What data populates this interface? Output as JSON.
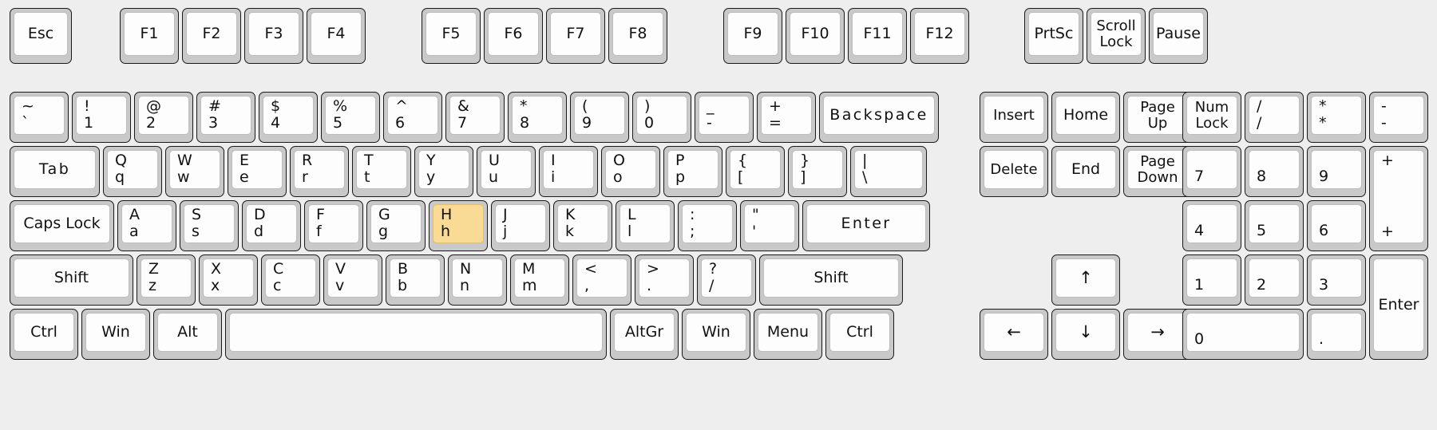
{
  "keyboard": {
    "name": "full-size-104-key-layout",
    "highlight_color": "#fadb95",
    "key_face_color": "#fdfdfd",
    "key_body_color": "#c9c9c9",
    "background_color": "#eeeeee",
    "highlighted_keys": [
      "H"
    ],
    "rows": {
      "function_row": [
        {
          "id": "esc",
          "label": "Esc",
          "type": "single"
        },
        {
          "id": "f1",
          "label": "F1",
          "type": "single"
        },
        {
          "id": "f2",
          "label": "F2",
          "type": "single"
        },
        {
          "id": "f3",
          "label": "F3",
          "type": "single"
        },
        {
          "id": "f4",
          "label": "F4",
          "type": "single"
        },
        {
          "id": "f5",
          "label": "F5",
          "type": "single"
        },
        {
          "id": "f6",
          "label": "F6",
          "type": "single"
        },
        {
          "id": "f7",
          "label": "F7",
          "type": "single"
        },
        {
          "id": "f8",
          "label": "F8",
          "type": "single"
        },
        {
          "id": "f9",
          "label": "F9",
          "type": "single"
        },
        {
          "id": "f10",
          "label": "F10",
          "type": "single"
        },
        {
          "id": "f11",
          "label": "F11",
          "type": "single"
        },
        {
          "id": "f12",
          "label": "F12",
          "type": "single"
        },
        {
          "id": "prtsc",
          "label": "PrtSc",
          "type": "single"
        },
        {
          "id": "scrolllock",
          "label": "Scroll\nLock",
          "type": "single"
        },
        {
          "id": "pause",
          "label": "Pause",
          "type": "single"
        }
      ],
      "number_row": [
        {
          "id": "backtick",
          "top": "~",
          "bottom": "`"
        },
        {
          "id": "1",
          "top": "!",
          "bottom": "1"
        },
        {
          "id": "2",
          "top": "@",
          "bottom": "2"
        },
        {
          "id": "3",
          "top": "#",
          "bottom": "3"
        },
        {
          "id": "4",
          "top": "$",
          "bottom": "4"
        },
        {
          "id": "5",
          "top": "%",
          "bottom": "5"
        },
        {
          "id": "6",
          "top": "^",
          "bottom": "6"
        },
        {
          "id": "7",
          "top": "&",
          "bottom": "7"
        },
        {
          "id": "8",
          "top": "*",
          "bottom": "8"
        },
        {
          "id": "9",
          "top": "(",
          "bottom": "9"
        },
        {
          "id": "0",
          "top": ")",
          "bottom": "0"
        },
        {
          "id": "minus",
          "top": "_",
          "bottom": "-"
        },
        {
          "id": "equal",
          "top": "+",
          "bottom": "="
        },
        {
          "id": "backspace",
          "label": "Backspace",
          "type": "single"
        }
      ],
      "top_row": [
        {
          "id": "tab",
          "label": "Tab",
          "type": "single"
        },
        {
          "id": "q",
          "top": "Q",
          "bottom": "q"
        },
        {
          "id": "w",
          "top": "W",
          "bottom": "w"
        },
        {
          "id": "e",
          "top": "E",
          "bottom": "e"
        },
        {
          "id": "r",
          "top": "R",
          "bottom": "r"
        },
        {
          "id": "t",
          "top": "T",
          "bottom": "t"
        },
        {
          "id": "y",
          "top": "Y",
          "bottom": "y"
        },
        {
          "id": "u",
          "top": "U",
          "bottom": "u"
        },
        {
          "id": "i",
          "top": "I",
          "bottom": "i"
        },
        {
          "id": "o",
          "top": "O",
          "bottom": "o"
        },
        {
          "id": "p",
          "top": "P",
          "bottom": "p"
        },
        {
          "id": "lbracket",
          "top": "{",
          "bottom": "["
        },
        {
          "id": "rbracket",
          "top": "}",
          "bottom": "]"
        },
        {
          "id": "backslash",
          "top": "|",
          "bottom": "\\"
        }
      ],
      "home_row": [
        {
          "id": "capslock",
          "label": "Caps Lock",
          "type": "single"
        },
        {
          "id": "a",
          "top": "A",
          "bottom": "a"
        },
        {
          "id": "s",
          "top": "S",
          "bottom": "s"
        },
        {
          "id": "d",
          "top": "D",
          "bottom": "d"
        },
        {
          "id": "f",
          "top": "F",
          "bottom": "f"
        },
        {
          "id": "g",
          "top": "G",
          "bottom": "g"
        },
        {
          "id": "h",
          "top": "H",
          "bottom": "h",
          "highlighted": true
        },
        {
          "id": "j",
          "top": "J",
          "bottom": "j"
        },
        {
          "id": "k",
          "top": "K",
          "bottom": "k"
        },
        {
          "id": "l",
          "top": "L",
          "bottom": "l"
        },
        {
          "id": "semicolon",
          "top": ":",
          "bottom": ";"
        },
        {
          "id": "quote",
          "top": "\"",
          "bottom": "'"
        },
        {
          "id": "enter",
          "label": "Enter",
          "type": "single"
        }
      ],
      "bottom_letter_row": [
        {
          "id": "lshift",
          "label": "Shift",
          "type": "single"
        },
        {
          "id": "z",
          "top": "Z",
          "bottom": "z"
        },
        {
          "id": "x",
          "top": "X",
          "bottom": "x"
        },
        {
          "id": "c",
          "top": "C",
          "bottom": "c"
        },
        {
          "id": "v",
          "top": "V",
          "bottom": "v"
        },
        {
          "id": "b",
          "top": "B",
          "bottom": "b"
        },
        {
          "id": "n",
          "top": "N",
          "bottom": "n"
        },
        {
          "id": "m",
          "top": "M",
          "bottom": "m"
        },
        {
          "id": "comma",
          "top": "<",
          "bottom": ","
        },
        {
          "id": "period",
          "top": ">",
          "bottom": "."
        },
        {
          "id": "slash",
          "top": "?",
          "bottom": "/"
        },
        {
          "id": "rshift",
          "label": "Shift",
          "type": "single"
        }
      ],
      "modifier_row": [
        {
          "id": "lctrl",
          "label": "Ctrl",
          "type": "single"
        },
        {
          "id": "lwin",
          "label": "Win",
          "type": "single"
        },
        {
          "id": "lalt",
          "label": "Alt",
          "type": "single"
        },
        {
          "id": "space",
          "label": "",
          "type": "single"
        },
        {
          "id": "altgr",
          "label": "AltGr",
          "type": "single"
        },
        {
          "id": "rwin",
          "label": "Win",
          "type": "single"
        },
        {
          "id": "menu",
          "label": "Menu",
          "type": "single"
        },
        {
          "id": "rctrl",
          "label": "Ctrl",
          "type": "single"
        }
      ],
      "nav_cluster": [
        {
          "id": "insert",
          "label": "Insert",
          "type": "single"
        },
        {
          "id": "home",
          "label": "Home",
          "type": "single"
        },
        {
          "id": "pageup",
          "label": "Page\nUp",
          "type": "single"
        },
        {
          "id": "delete",
          "label": "Delete",
          "type": "single"
        },
        {
          "id": "end",
          "label": "End",
          "type": "single"
        },
        {
          "id": "pagedown",
          "label": "Page\nDown",
          "type": "single"
        },
        {
          "id": "up",
          "label": "↑",
          "type": "arrow"
        },
        {
          "id": "left",
          "label": "←",
          "type": "arrow"
        },
        {
          "id": "down",
          "label": "↓",
          "type": "arrow"
        },
        {
          "id": "right",
          "label": "→",
          "type": "arrow"
        }
      ],
      "numpad": [
        {
          "id": "numlock",
          "label": "Num\nLock",
          "type": "single"
        },
        {
          "id": "numdivide",
          "top": "/",
          "bottom": "/"
        },
        {
          "id": "nummultiply",
          "top": "*",
          "bottom": "*"
        },
        {
          "id": "numminus",
          "top": "-",
          "bottom": "-"
        },
        {
          "id": "num7",
          "label": "7",
          "type": "digit"
        },
        {
          "id": "num8",
          "label": "8",
          "type": "digit"
        },
        {
          "id": "num9",
          "label": "9",
          "type": "digit"
        },
        {
          "id": "numplus",
          "top": "+",
          "bottom": "+"
        },
        {
          "id": "num4",
          "label": "4",
          "type": "digit"
        },
        {
          "id": "num5",
          "label": "5",
          "type": "digit"
        },
        {
          "id": "num6",
          "label": "6",
          "type": "digit"
        },
        {
          "id": "num1",
          "label": "1",
          "type": "digit"
        },
        {
          "id": "num2",
          "label": "2",
          "type": "digit"
        },
        {
          "id": "num3",
          "label": "3",
          "type": "digit"
        },
        {
          "id": "numenter",
          "label": "Enter",
          "type": "single"
        },
        {
          "id": "num0",
          "label": "0",
          "type": "digit"
        },
        {
          "id": "numdot",
          "label": ".",
          "type": "digit"
        }
      ]
    }
  }
}
